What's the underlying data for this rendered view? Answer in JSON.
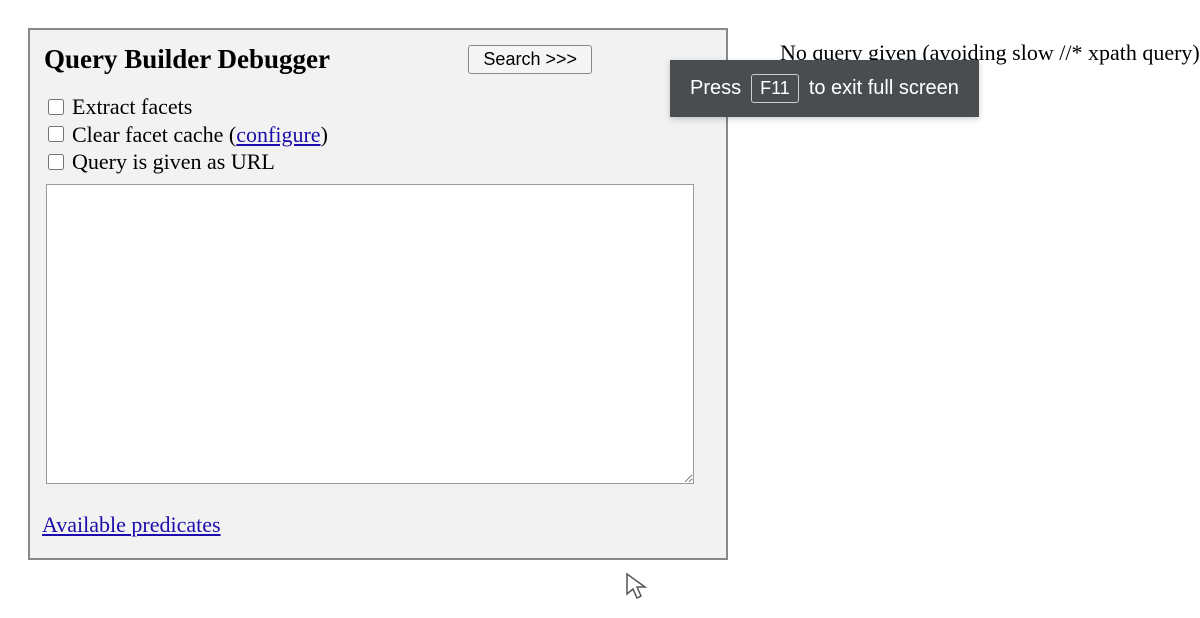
{
  "panel": {
    "title": "Query Builder Debugger",
    "search_button_label": "Search >>>",
    "options": {
      "extract_facets_label": "Extract facets",
      "clear_facet_cache_label_pre": "Clear facet cache (",
      "clear_facet_cache_link": "configure",
      "clear_facet_cache_label_post": ")",
      "query_as_url_label": "Query is given as URL"
    },
    "textarea_value": "",
    "predicates_link_label": "Available predicates"
  },
  "status": {
    "message": "No query given (avoiding slow //* xpath query)."
  },
  "toast": {
    "press_label": "Press",
    "key_label": "F11",
    "exit_label": "to exit full screen"
  }
}
